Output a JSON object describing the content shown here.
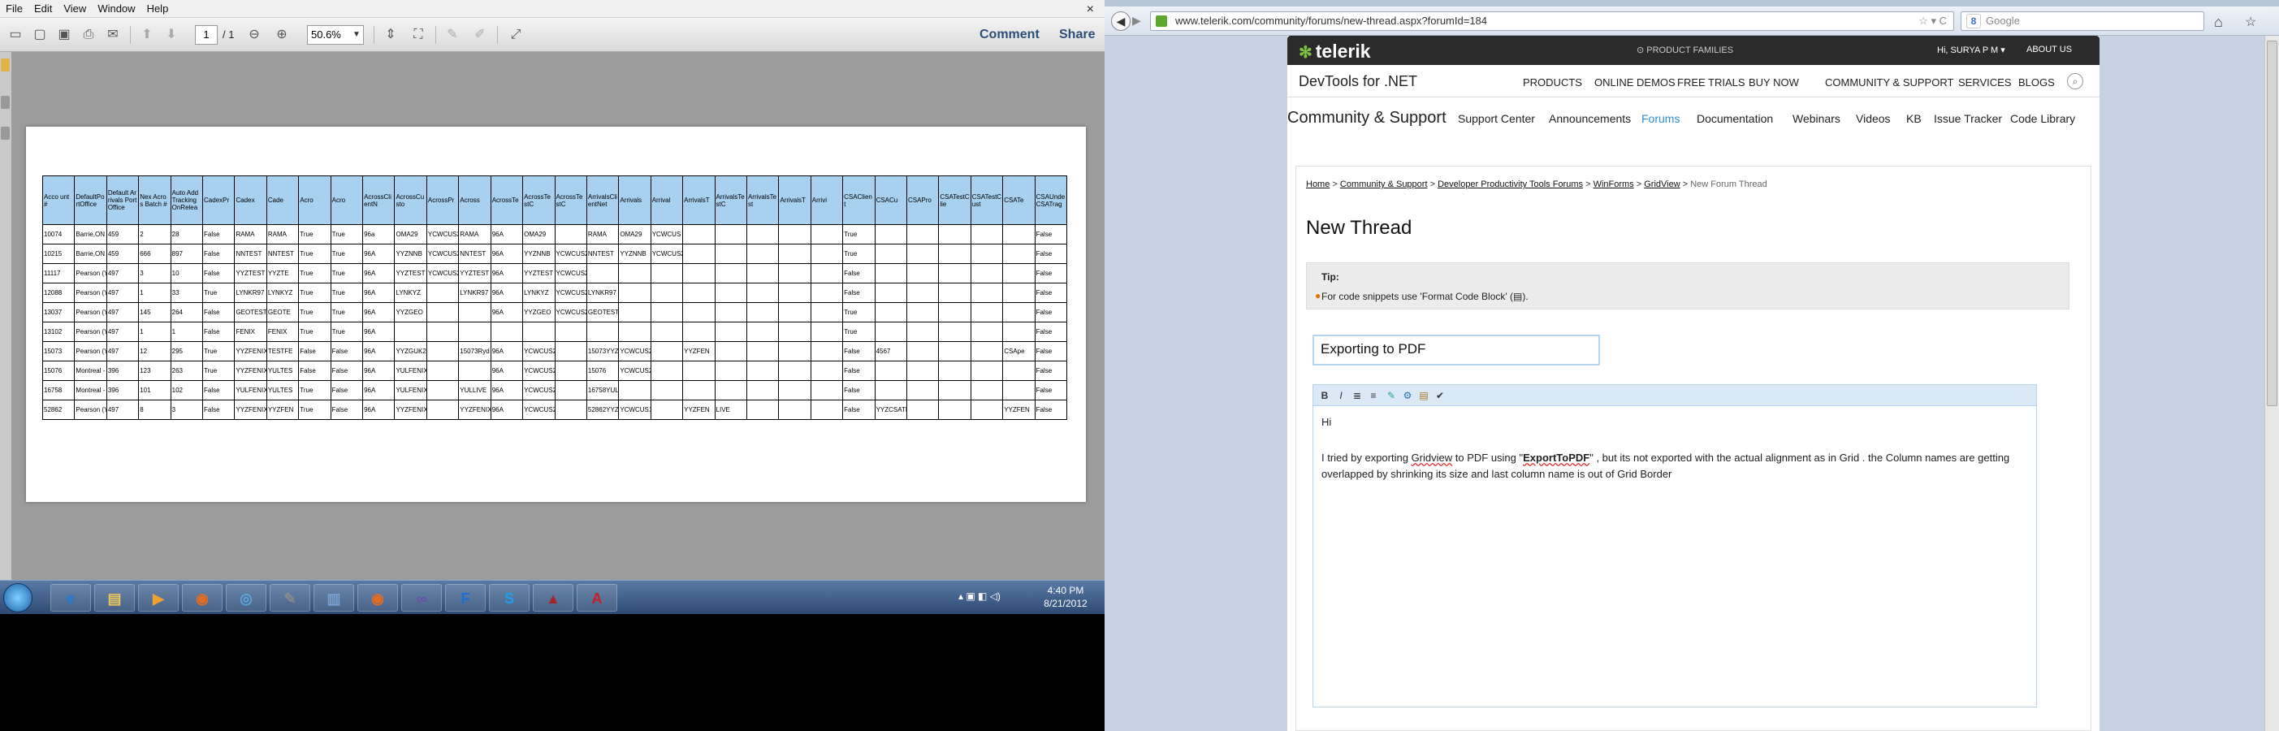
{
  "pdf": {
    "menu": [
      "File",
      "Edit",
      "View",
      "Window",
      "Help"
    ],
    "close": "×",
    "page_current": "1",
    "page_total": "/ 1",
    "zoom": "50.6%",
    "comment": "Comment",
    "share": "Share",
    "table": {
      "headers": [
        "Acco unt #",
        "DefaultPortOffice",
        "Default Arrivals Port Office",
        "Nex Acros Batch #",
        "Auto Add Tracking OnRelea",
        "CadexPr",
        "Cadex",
        "Cade",
        "Acro",
        "Acro",
        "AcrossClientN",
        "AcrossCusto",
        "AcrossPr",
        "Across",
        "AcrossTe",
        "AcrossTestC",
        "AcrossTestC",
        "ArrivalsClientNet",
        "Arrivals",
        "Arrival",
        "ArrivalsT",
        "ArrivalsTestC",
        "ArrivalsTest",
        "ArrivalsT",
        "Arrivi",
        "CSAClient",
        "CSACu",
        "CSAPro",
        "CSATestClie",
        "CSATestCust",
        "CSATe",
        "CSAUnde CSATrag"
      ],
      "rows": [
        [
          "10074",
          "Barrie,ON",
          "459",
          "2",
          "28",
          "False",
          "RAMA",
          "RAMA",
          "True",
          "True",
          "96a",
          "OMA29",
          "YCWCUS2",
          "RAMA",
          "96A",
          "OMA29",
          "",
          "RAMA",
          "OMA29",
          "YCWCUS",
          "",
          "",
          "",
          "",
          "",
          "True",
          "",
          "",
          "",
          "",
          "",
          "False"
        ],
        [
          "10215",
          "Barrie,ON",
          "459",
          "666",
          "897",
          "False",
          "NNTEST",
          "NNTEST",
          "True",
          "True",
          "96A",
          "YYZNNB",
          "YCWCUS2",
          "NNTEST",
          "96A",
          "YYZNNB",
          "YCWCUS2",
          "NNTEST",
          "YYZNNB",
          "YCWCUS2",
          "",
          "",
          "",
          "",
          "",
          "True",
          "",
          "",
          "",
          "",
          "",
          "False"
        ],
        [
          "11117",
          "Pearson (YYZ)",
          "497",
          "3",
          "10",
          "False",
          "YYZTEST",
          "YYZTE",
          "True",
          "True",
          "96A",
          "YYZTEST",
          "YCWCUS2",
          "YYZTEST",
          "96A",
          "YYZTEST",
          "YCWCUS2",
          "",
          "",
          "",
          "",
          "",
          "",
          "",
          "",
          "False",
          "",
          "",
          "",
          "",
          "",
          "False"
        ],
        [
          "12088",
          "Pearson (YYZ)",
          "497",
          "1",
          "33",
          "True",
          "LYNKR97",
          "LYNKYZ",
          "True",
          "True",
          "96A",
          "LYNKYZ",
          "",
          "LYNKR97",
          "96A",
          "LYNKYZ",
          "YCWCUS2",
          "LYNKR97",
          "",
          "",
          "",
          "",
          "",
          "",
          "",
          "False",
          "",
          "",
          "",
          "",
          "",
          "False"
        ],
        [
          "13037",
          "Pearson (YYZ)",
          "497",
          "145",
          "264",
          "False",
          "GEOTEST",
          "GEOTE",
          "True",
          "True",
          "96A",
          "YYZGEO",
          "",
          "",
          "96A",
          "YYZGEO",
          "YCWCUS2",
          "GEOTEST",
          "",
          "",
          "",
          "",
          "",
          "",
          "",
          "True",
          "",
          "",
          "",
          "",
          "",
          "False"
        ],
        [
          "13102",
          "Pearson (YYZ)",
          "497",
          "1",
          "1",
          "False",
          "FENIX",
          "FENIX",
          "True",
          "True",
          "96A",
          "",
          "",
          "",
          "",
          "",
          "",
          "",
          "",
          "",
          "",
          "",
          "",
          "",
          "",
          "True",
          "",
          "",
          "",
          "",
          "",
          "False"
        ],
        [
          "15073",
          "Pearson (YYZ)",
          "497",
          "12",
          "295",
          "True",
          "YYZFENIX",
          "TESTFE",
          "False",
          "False",
          "96A",
          "YYZGUK2",
          "",
          "15073Ryd",
          "96A",
          "YCWCUS2",
          "",
          "15073YYZEXP",
          "YCWCUS2",
          "",
          "YYZFEN",
          "",
          "",
          "",
          "",
          "False",
          "4567",
          "",
          "",
          "",
          "CSApe",
          "False"
        ],
        [
          "15076",
          "Montreal - Dorval (YUL)",
          "396",
          "123",
          "263",
          "True",
          "YYZFENIX",
          "YULTES",
          "False",
          "False",
          "96A",
          "YULFENIX",
          "",
          "",
          "96A",
          "YCWCUS2",
          "",
          "15076",
          "YCWCUS2",
          "",
          "",
          "",
          "",
          "",
          "",
          "False",
          "",
          "",
          "",
          "",
          "",
          "False"
        ],
        [
          "16758",
          "Montreal - Dorval (YUL)",
          "396",
          "101",
          "102",
          "False",
          "YULFENIX",
          "YULTES",
          "True",
          "False",
          "96A",
          "YULFENIX",
          "",
          "YULLIVE",
          "96A",
          "YCWCUS2",
          "",
          "16758YULTEST",
          "",
          "",
          "",
          "",
          "",
          "",
          "",
          "False",
          "",
          "",
          "",
          "",
          "",
          "False"
        ],
        [
          "52862",
          "Pearson (YYZ)",
          "497",
          "8",
          "3",
          "False",
          "YYZFENIX",
          "YYZFEN",
          "True",
          "False",
          "96A",
          "YYZFENIX",
          "",
          "YYZFENIX",
          "96A",
          "YCWCUS2",
          "",
          "52862YYZFENIXT",
          "YCWCUS1",
          "",
          "YYZFEN",
          "LIVE",
          "",
          "",
          "",
          "False",
          "YYZCSATEST",
          "",
          "",
          "",
          "YYZFEN",
          "False"
        ]
      ]
    }
  },
  "taskbar": {
    "time": "4:40 PM",
    "date": "8/21/2012",
    "tray": "▴ ▣ ◧ ◁)",
    "apps": [
      "e",
      "▤",
      "▶",
      "◉",
      "◎",
      "✎",
      "▥",
      "◉",
      "∞",
      "F",
      "S",
      "▲",
      "A"
    ]
  },
  "browser": {
    "url": "www.telerik.com/community/forums/new-thread.aspx?forumId=184",
    "url_icons": "☆ ▾ C",
    "search_placeholder": "Google",
    "search_engine_letter": "8",
    "home": "⌂",
    "bookmark": "☆"
  },
  "site": {
    "logo": "telerik",
    "product_families": "PRODUCT FAMILIES",
    "user": "Hi, SURYA P M ▾",
    "about": "ABOUT US",
    "devtools": "DevTools for .NET",
    "main_nav": [
      "PRODUCTS",
      "ONLINE DEMOS",
      "FREE TRIALS",
      "BUY NOW",
      "COMMUNITY & SUPPORT",
      "SERVICES",
      "BLOGS"
    ],
    "community_title": "Community & Support",
    "sub_nav": [
      "Support Center",
      "Announcements",
      "Forums",
      "Documentation",
      "Webinars",
      "Videos",
      "KB",
      "Issue Tracker",
      "Code Library"
    ],
    "active_sub": "Forums",
    "crumbs": [
      "Home",
      "Community & Support",
      "Developer Productivity Tools Forums",
      "WinForms",
      "GridView",
      "New Forum Thread"
    ],
    "crumb_sep": ">",
    "page_title": "New Thread",
    "tip_label": "Tip:",
    "tip_text_pre": "For code snippets use 'Format Code Block' (",
    "tip_text_post": ").",
    "tip_icon": "▤",
    "subject": "Exporting to PDF",
    "editor_buttons": [
      "B",
      "I",
      "≣",
      "≡",
      "✎",
      "⚙",
      "▤",
      "✔"
    ],
    "editor": {
      "greeting": "Hi",
      "p1": "I tried by  exporting ",
      "p1_gridview": "Gridview",
      "p1_mid": " to PDF using \"",
      "p1_bold": "ExportToPDF",
      "p1_end": "\" , but its not exported with the actual alignment as in Grid . the Column names are getting overlapped by shrinking its size and last column name is out of Grid Border"
    }
  }
}
